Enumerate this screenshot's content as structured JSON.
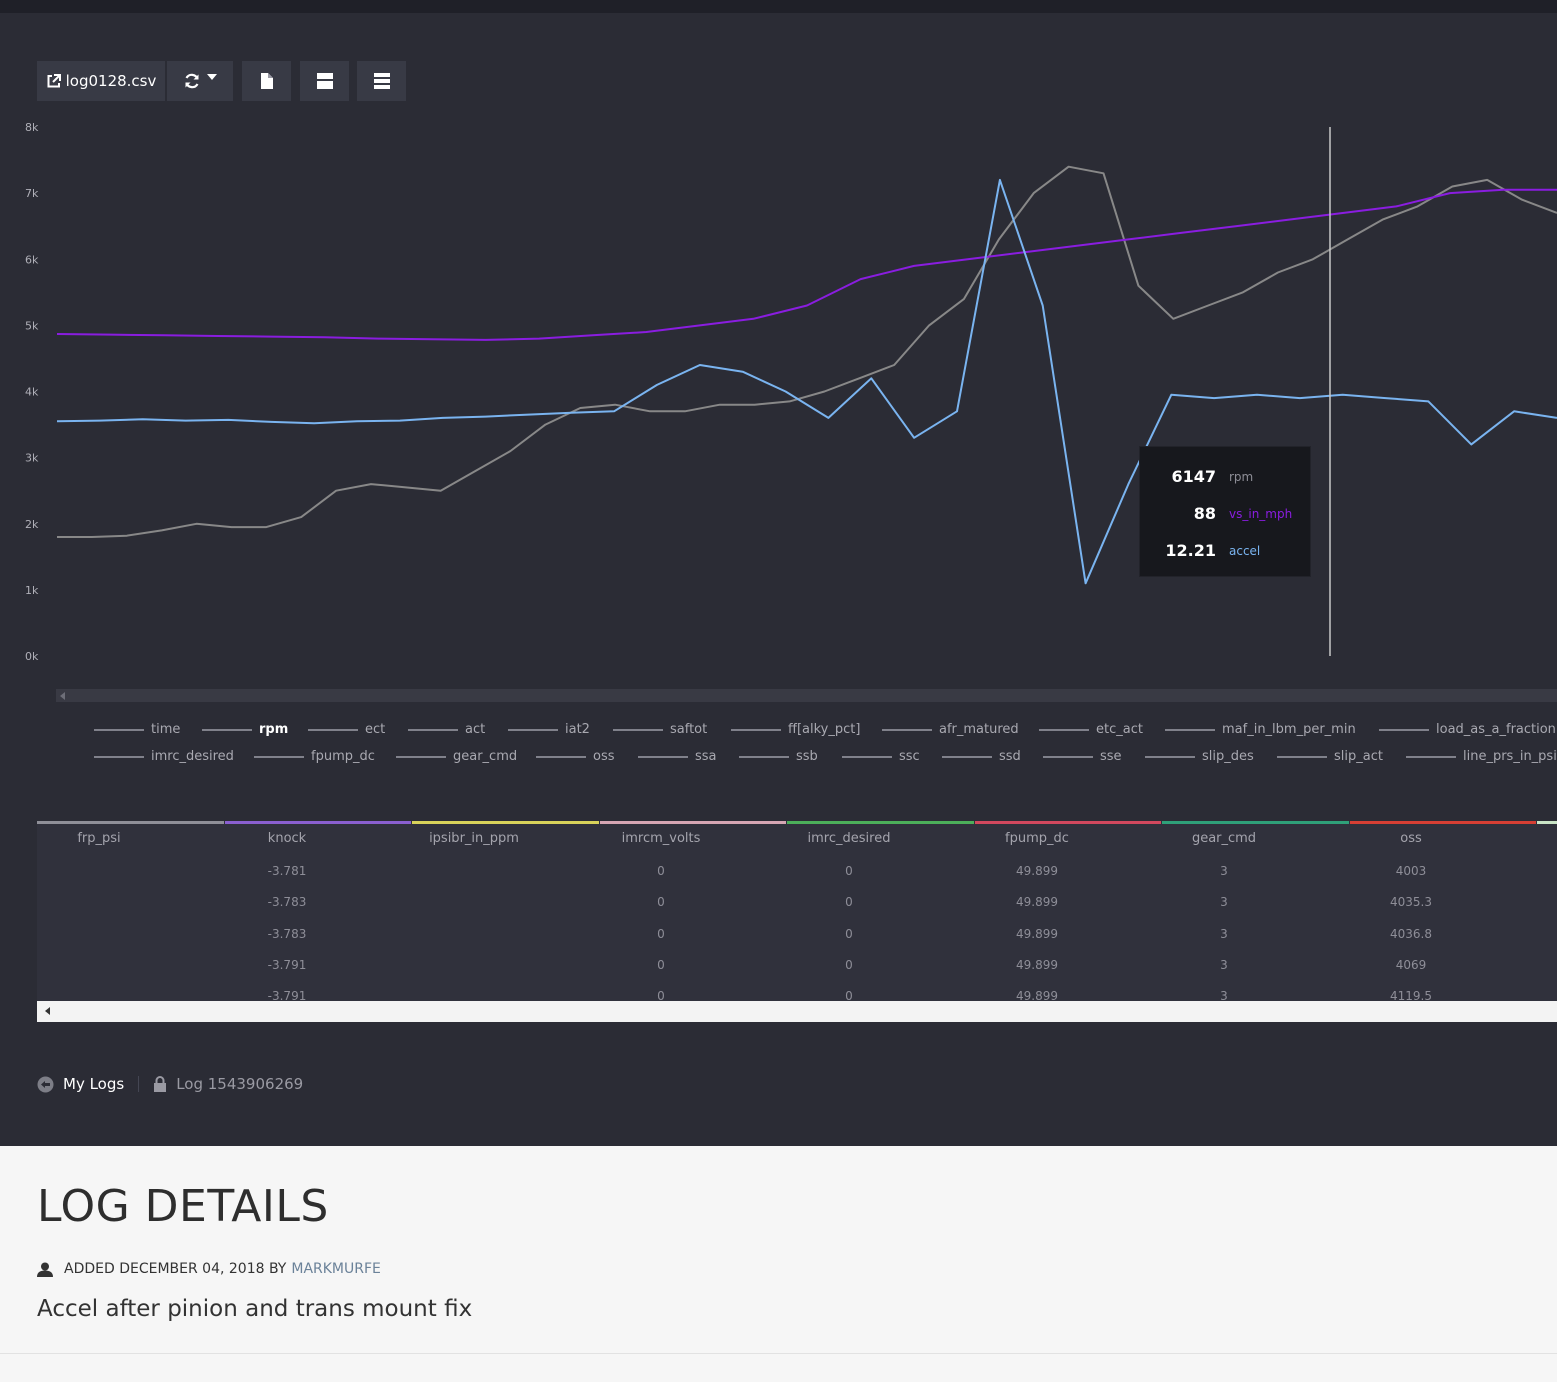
{
  "toolbar": {
    "file_label": "log0128.csv",
    "buttons": [
      "external-link-icon",
      "refresh-icon",
      "file-icon",
      "single-view-icon",
      "list-view-icon"
    ]
  },
  "chart_data": {
    "type": "line",
    "yticks": [
      "8k",
      "7k",
      "6k",
      "5k",
      "4k",
      "3k",
      "2k",
      "1k",
      "0k"
    ],
    "ylim": [
      0,
      8000
    ],
    "x": [
      0,
      3,
      6,
      9,
      12,
      15,
      18,
      21,
      24,
      27,
      30,
      33,
      36,
      39,
      42,
      45,
      48,
      51,
      54,
      57,
      60,
      63,
      66,
      69,
      72,
      75,
      78,
      81,
      84,
      87,
      90,
      93,
      96,
      99
    ],
    "series": [
      {
        "name": "rpm",
        "color": "#888888",
        "values": [
          1800,
          1800,
          1820,
          1900,
          2000,
          1950,
          1950,
          2100,
          2500,
          2600,
          2550,
          2500,
          2800,
          3100,
          3500,
          3750,
          3800,
          3700,
          3700,
          3800,
          3800,
          3850,
          4000,
          4200,
          4400,
          5000,
          5400,
          6300,
          7000,
          7400,
          7300,
          5600,
          5100,
          5300,
          5500,
          5800,
          6000,
          6300,
          6600,
          6800,
          7100,
          7200,
          6900,
          6700
        ]
      },
      {
        "name": "vs_in_mph",
        "color": "#8a1de0",
        "values": [
          4870,
          4860,
          4850,
          4840,
          4830,
          4820,
          4800,
          4790,
          4780,
          4800,
          4850,
          4900,
          5000,
          5100,
          5300,
          5700,
          5900,
          6000,
          6100,
          6200,
          6300,
          6400,
          6500,
          6600,
          6700,
          6800,
          7000,
          7050,
          7050
        ]
      },
      {
        "name": "accel",
        "color": "#7ab4f0",
        "values": [
          3550,
          3560,
          3580,
          3560,
          3570,
          3540,
          3520,
          3550,
          3560,
          3600,
          3620,
          3650,
          3680,
          3700,
          4100,
          4400,
          4300,
          4000,
          3600,
          4200,
          3300,
          3700,
          7200,
          5300,
          1100,
          2600,
          3950,
          3900,
          3950,
          3900,
          3950,
          3900,
          3850,
          3200,
          3700,
          3600
        ]
      }
    ],
    "tooltip": [
      {
        "value": "6147",
        "label": "rpm"
      },
      {
        "value": "88",
        "label": "vs_in_mph"
      },
      {
        "value": "12.21",
        "label": "accel"
      }
    ]
  },
  "legend": {
    "row1": [
      "time",
      "rpm",
      "ect",
      "act",
      "iat2",
      "saftot",
      "ff[alky_pct]",
      "afr_matured",
      "etc_act",
      "maf_in_lbm_per_min",
      "load_as_a_fraction"
    ],
    "row2": [
      "imrc_desired",
      "fpump_dc",
      "gear_cmd",
      "oss",
      "ssa",
      "ssb",
      "ssc",
      "ssd",
      "sse",
      "slip_des",
      "slip_act",
      "line_prs_in_psi"
    ]
  },
  "table": {
    "headers": [
      "frp_psi",
      "knock",
      "ipsibr_in_ppm",
      "imrcm_volts",
      "imrc_desired",
      "fpump_dc",
      "gear_cmd",
      "oss"
    ],
    "header_colors": [
      "#8f8f98",
      "#8a5fd0",
      "#d8d25a",
      "#d6a6b4",
      "#4caf5a",
      "#d2485e",
      "#2fa079",
      "#d63f34",
      "#c9e4c6"
    ],
    "rows": [
      [
        "",
        "-3.781",
        "",
        "0",
        "0",
        "49.899",
        "3",
        "4003"
      ],
      [
        "",
        "-3.783",
        "",
        "0",
        "0",
        "49.899",
        "3",
        "4035.3"
      ],
      [
        "",
        "-3.783",
        "",
        "0",
        "0",
        "49.899",
        "3",
        "4036.8"
      ],
      [
        "",
        "-3.791",
        "",
        "0",
        "0",
        "49.899",
        "3",
        "4069"
      ],
      [
        "",
        "-3.791",
        "",
        "0",
        "0",
        "49.899",
        "3",
        "4119.5"
      ]
    ]
  },
  "breadcrumb": {
    "my_logs": "My Logs",
    "log_name": "Log 1543906269"
  },
  "details": {
    "title": "LOG DETAILS",
    "added": "ADDED DECEMBER 04, 2018 BY",
    "author": "MARKMURFE",
    "description": "Accel after pinion and trans mount fix"
  }
}
